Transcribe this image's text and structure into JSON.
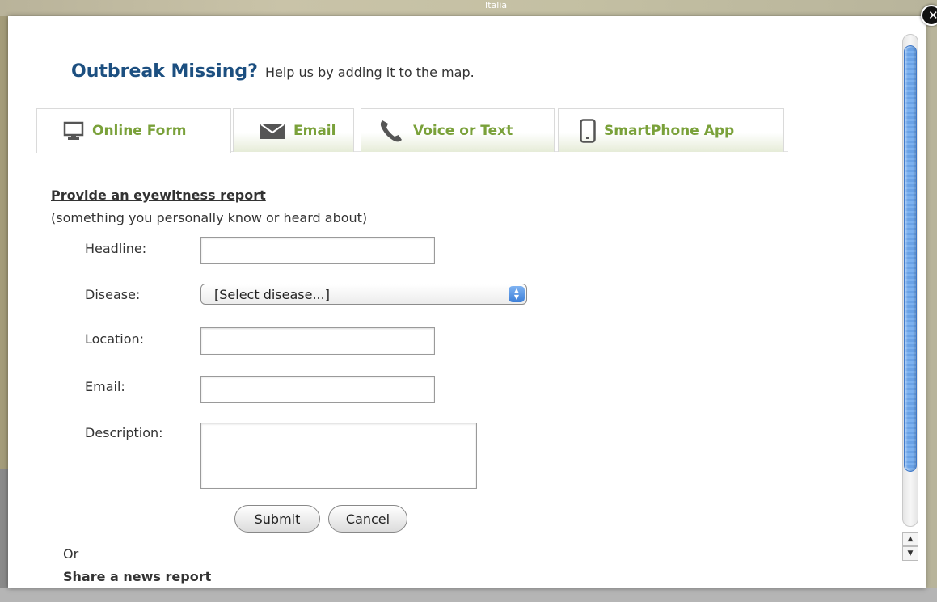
{
  "map": {
    "label": "Italia"
  },
  "modal": {
    "title_bold": "Outbreak Missing?",
    "title_rest": "Help us by adding it to the map.",
    "tabs": [
      {
        "label": "Online Form",
        "icon": "monitor-icon",
        "active": true
      },
      {
        "label": "Email",
        "icon": "envelope-icon",
        "active": false
      },
      {
        "label": "Voice or Text",
        "icon": "phone-icon",
        "active": false
      },
      {
        "label": "SmartPhone App",
        "icon": "smartphone-icon",
        "active": false
      }
    ],
    "form": {
      "section_heading": "Provide an eyewitness report",
      "section_subtitle": "(something you personally know or heard about)",
      "headline_label": "Headline:",
      "headline_value": "",
      "disease_label": "Disease:",
      "disease_selected": "[Select disease...]",
      "location_label": "Location:",
      "location_value": "",
      "email_label": "Email:",
      "email_value": "",
      "description_label": "Description:",
      "description_value": "",
      "submit_label": "Submit",
      "cancel_label": "Cancel"
    },
    "or_text": "Or",
    "next_section_cut": "Share a news report"
  },
  "colors": {
    "title_blue": "#1c4f80",
    "tab_green": "#7aa13a",
    "scroll_blue": "#7cb1ef"
  }
}
